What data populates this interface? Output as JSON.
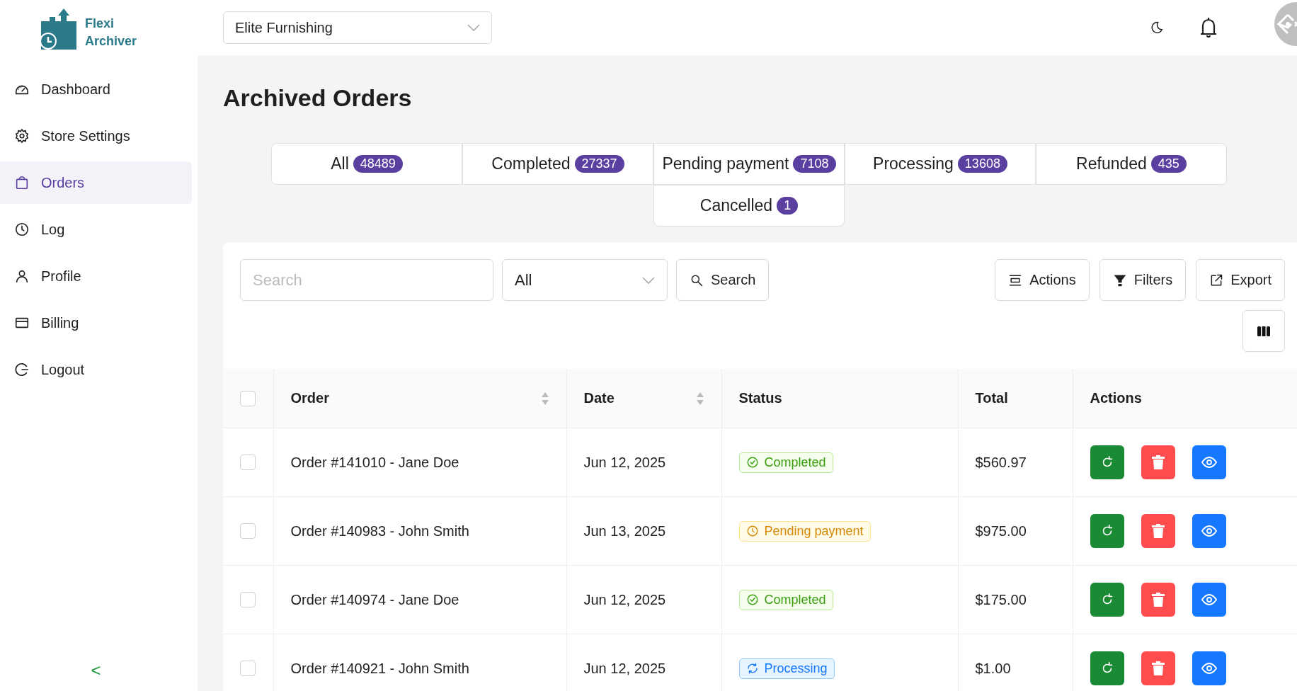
{
  "brand": {
    "line1": "Flexi",
    "line2": "Archiver"
  },
  "store_select": {
    "value": "Elite Furnishing"
  },
  "sidebar": {
    "items": [
      {
        "label": "Dashboard",
        "selected": false
      },
      {
        "label": "Store Settings",
        "selected": false
      },
      {
        "label": "Orders",
        "selected": true
      },
      {
        "label": "Log",
        "selected": false
      },
      {
        "label": "Profile",
        "selected": false
      },
      {
        "label": "Billing",
        "selected": false
      },
      {
        "label": "Logout",
        "selected": false
      }
    ],
    "collapse": "<"
  },
  "page_title": "Archived Orders",
  "tabs": [
    {
      "label": "All",
      "count": "48489"
    },
    {
      "label": "Completed",
      "count": "27337"
    },
    {
      "label": "Pending payment",
      "count": "7108"
    },
    {
      "label": "Processing",
      "count": "13608"
    },
    {
      "label": "Refunded",
      "count": "435"
    },
    {
      "label": "Cancelled",
      "count": "1"
    }
  ],
  "toolbar": {
    "search": {
      "placeholder": "Search"
    },
    "status_select": {
      "value": "All"
    },
    "search_button": "Search",
    "actions_button": "Actions",
    "filters_button": "Filters",
    "export_button": "Export"
  },
  "table": {
    "select_all_checked": false,
    "columns": [
      {
        "label": "Order",
        "sortable": true
      },
      {
        "label": "Date",
        "sortable": true
      },
      {
        "label": "Status",
        "sortable": false
      },
      {
        "label": "Total",
        "sortable": false
      },
      {
        "label": "Actions",
        "sortable": false
      }
    ],
    "rows": [
      {
        "checked": false,
        "order": "Order #141010 - Jane Doe",
        "date": "Jun 12, 2025",
        "status": {
          "label": "Completed",
          "kind": "completed"
        },
        "total": "$560.97"
      },
      {
        "checked": false,
        "order": "Order #140983 - John Smith",
        "date": "Jun 13, 2025",
        "status": {
          "label": "Pending payment",
          "kind": "pending"
        },
        "total": "$975.00"
      },
      {
        "checked": false,
        "order": "Order #140974 - Jane Doe",
        "date": "Jun 12, 2025",
        "status": {
          "label": "Completed",
          "kind": "completed"
        },
        "total": "$175.00"
      },
      {
        "checked": false,
        "order": "Order #140921 - John Smith",
        "date": "Jun 12, 2025",
        "status": {
          "label": "Processing",
          "kind": "processing"
        },
        "total": "$1.00"
      }
    ]
  }
}
